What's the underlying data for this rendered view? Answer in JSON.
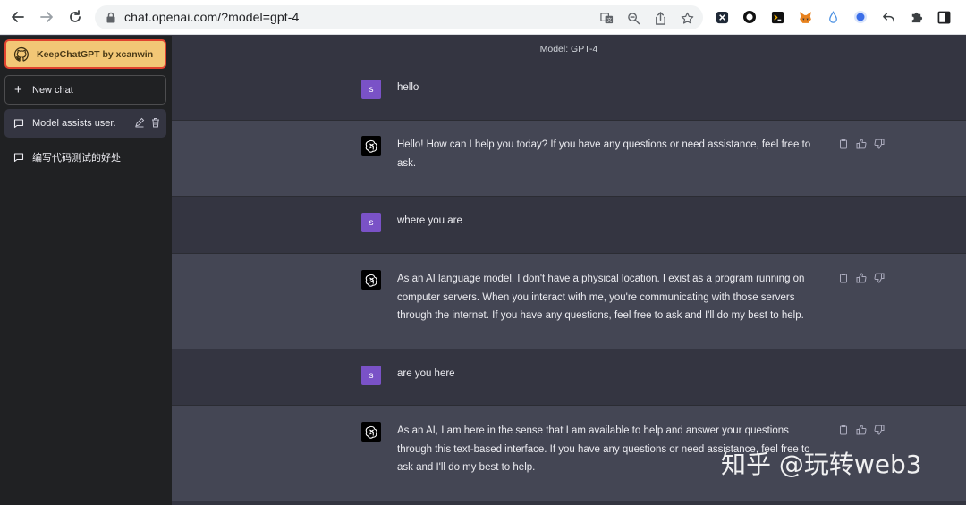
{
  "browser": {
    "url": "chat.openai.com/?model=gpt-4"
  },
  "sidebar": {
    "extension_button": "KeepChatGPT by xcanwin",
    "new_chat": "New chat",
    "conversations": [
      {
        "label": "Model assists user."
      },
      {
        "label": "编写代码测试的好处"
      }
    ]
  },
  "main": {
    "model_label": "Model: GPT-4",
    "messages": [
      {
        "role": "user",
        "avatar": "s",
        "text": "hello"
      },
      {
        "role": "assistant",
        "text": "Hello! How can I help you today? If you have any questions or need assistance, feel free to ask."
      },
      {
        "role": "user",
        "avatar": "s",
        "text": "where you are"
      },
      {
        "role": "assistant",
        "text": "As an AI language model, I don't have a physical location. I exist as a program running on computer servers. When you interact with me, you're communicating with those servers through the internet. If you have any questions, feel free to ask and I'll do my best to help."
      },
      {
        "role": "user",
        "avatar": "s",
        "text": "are you here"
      },
      {
        "role": "assistant",
        "text": "As an AI, I am here in the sense that I am available to help and answer your questions through this text-based interface. If you have any questions or need assistance, feel free to ask and I'll do my best to help."
      }
    ]
  },
  "watermark": "知乎 @玩转web3",
  "colors": {
    "sidebar_bg": "#202123",
    "main_bg": "#343541",
    "assistant_bg": "#444654",
    "user_avatar": "#7a52c7",
    "extension_button_bg": "#f2c776",
    "extension_button_border": "#e0432f"
  }
}
